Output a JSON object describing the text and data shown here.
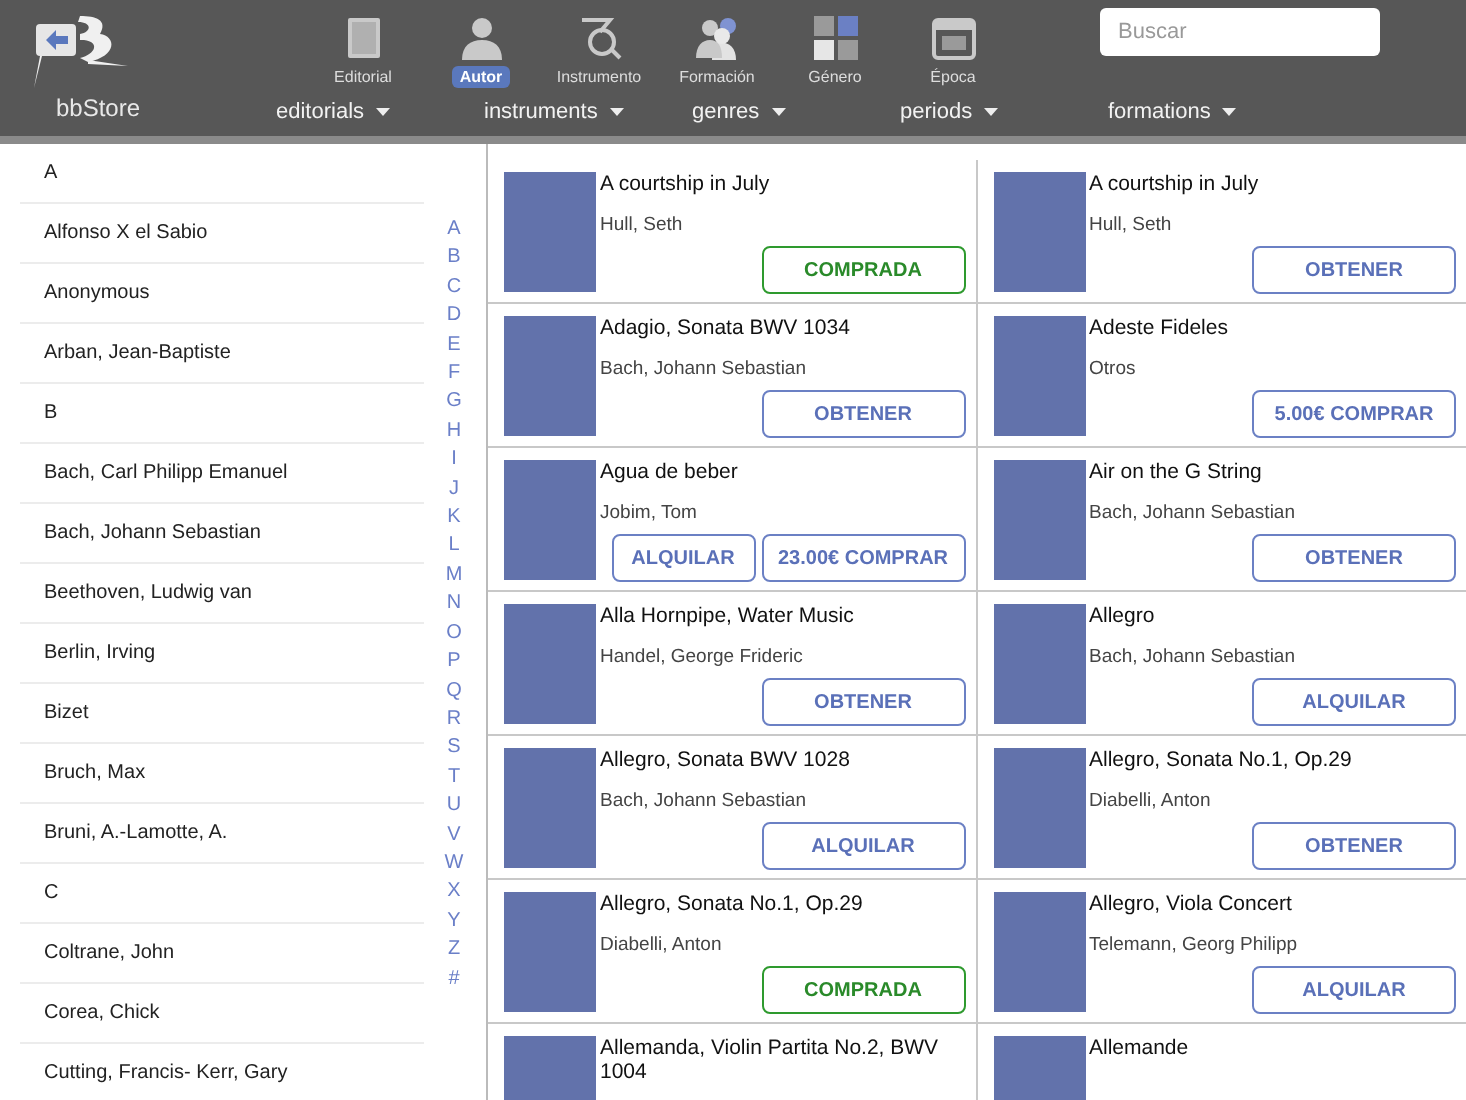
{
  "logo": {
    "text": "bbStore"
  },
  "nav": [
    {
      "label": "Editorial",
      "selected": false
    },
    {
      "label": "Autor",
      "selected": true
    },
    {
      "label": "Instrumento",
      "selected": false
    },
    {
      "label": "Formación",
      "selected": false
    },
    {
      "label": "Género",
      "selected": false
    },
    {
      "label": "Época",
      "selected": false
    }
  ],
  "search": {
    "placeholder": "Buscar"
  },
  "filters": [
    "editorials",
    "instruments",
    "genres",
    "periods",
    "formations"
  ],
  "authors": [
    "A",
    "Alfonso X el Sabio",
    "Anonymous",
    "Arban, Jean-Baptiste",
    "B",
    "Bach, Carl Philipp Emanuel",
    "Bach, Johann Sebastian",
    "Beethoven, Ludwig van",
    "Berlin, Irving",
    "Bizet",
    "Bruch, Max",
    "Bruni, A.-Lamotte, A.",
    "C",
    "Coltrane, John",
    "Corea, Chick",
    "Cutting, Francis- Kerr, Gary"
  ],
  "index": [
    "A",
    "B",
    "C",
    "D",
    "E",
    "F",
    "G",
    "H",
    "I",
    "J",
    "K",
    "L",
    "M",
    "N",
    "O",
    "P",
    "Q",
    "R",
    "S",
    "T",
    "U",
    "V",
    "W",
    "X",
    "Y",
    "Z",
    "#"
  ],
  "scores": [
    {
      "title": "A courtship in July",
      "composer": "Hull, Seth",
      "buttons": [
        {
          "label": "COMPRADA",
          "kind": "purchased"
        }
      ]
    },
    {
      "title": "A courtship in July",
      "composer": "Hull, Seth",
      "buttons": [
        {
          "label": "OBTENER",
          "kind": "action"
        }
      ]
    },
    {
      "title": "Adagio, Sonata BWV 1034",
      "composer": "Bach, Johann Sebastian",
      "buttons": [
        {
          "label": "OBTENER",
          "kind": "action"
        }
      ]
    },
    {
      "title": "Adeste Fideles",
      "composer": "Otros",
      "buttons": [
        {
          "label": "5.00€ COMPRAR",
          "kind": "action"
        }
      ]
    },
    {
      "title": "Agua de beber",
      "composer": "Jobim, Tom",
      "buttons": [
        {
          "label": "ALQUILAR",
          "kind": "action"
        },
        {
          "label": "23.00€ COMPRAR",
          "kind": "action"
        }
      ]
    },
    {
      "title": "Air on the G String",
      "composer": "Bach, Johann Sebastian",
      "buttons": [
        {
          "label": "OBTENER",
          "kind": "action"
        }
      ]
    },
    {
      "title": "Alla Hornpipe, Water Music",
      "composer": "Handel, George Frideric",
      "buttons": [
        {
          "label": "OBTENER",
          "kind": "action"
        }
      ]
    },
    {
      "title": "Allegro",
      "composer": "Bach, Johann Sebastian",
      "buttons": [
        {
          "label": "ALQUILAR",
          "kind": "action"
        }
      ]
    },
    {
      "title": "Allegro, Sonata BWV 1028",
      "composer": "Bach, Johann Sebastian",
      "buttons": [
        {
          "label": "ALQUILAR",
          "kind": "action"
        }
      ]
    },
    {
      "title": "Allegro, Sonata No.1, Op.29",
      "composer": "Diabelli, Anton",
      "buttons": [
        {
          "label": "OBTENER",
          "kind": "action"
        }
      ]
    },
    {
      "title": "Allegro, Sonata No.1, Op.29",
      "composer": "Diabelli, Anton",
      "buttons": [
        {
          "label": "COMPRADA",
          "kind": "purchased"
        }
      ]
    },
    {
      "title": "Allegro, Viola Concert",
      "composer": "Telemann, Georg Philipp",
      "buttons": [
        {
          "label": "ALQUILAR",
          "kind": "action"
        }
      ]
    },
    {
      "title": "Allemanda, Violin Partita No.2, BWV 1004"
    },
    {
      "title": "Allemande"
    }
  ]
}
